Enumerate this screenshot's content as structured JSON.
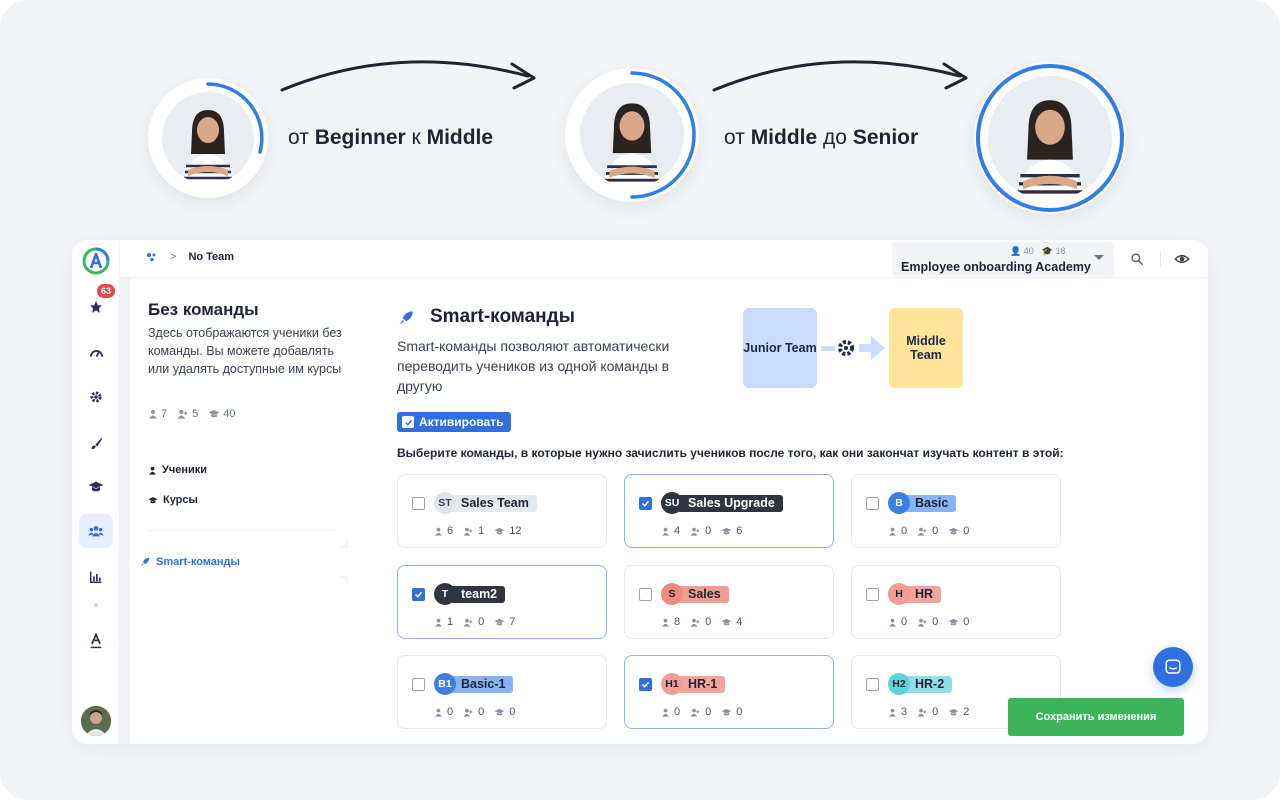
{
  "hero": {
    "step1": {
      "prefix": "от",
      "from": "Beginner",
      "mid": "к",
      "to": "Middle"
    },
    "step2": {
      "prefix": "от",
      "from": "Middle",
      "mid": "до",
      "to": "Senior"
    },
    "progress": [
      0.3,
      0.55,
      1.0
    ]
  },
  "breadcrumb": {
    "current": "No Team"
  },
  "academy": {
    "name": "Employee onboarding Academy",
    "users": "40",
    "courses": "18"
  },
  "sidebar": {
    "favorites_badge": "63"
  },
  "left_panel": {
    "title": "Без команды",
    "description": "Здесь отображаются ученики без команды. Вы можете добавлять или удалять доступные им курсы",
    "stats": {
      "users": "7",
      "teams": "5",
      "courses": "40"
    },
    "links": {
      "students": "Ученики",
      "courses": "Курсы",
      "smart_teams": "Smart-команды"
    }
  },
  "smart": {
    "title": "Smart-команды",
    "description": "Smart-команды позволяют автоматически переводить учеников из одной команды в другую",
    "activate_label": "Активировать",
    "instruction": "Выберите команды, в которые нужно зачислить учеников после того, как они закончат изучать контент в этой:",
    "illustration": {
      "from": "Junior Team",
      "to": "Middle Team"
    }
  },
  "teams": [
    {
      "initials": "ST",
      "name": "Sales Team",
      "checked": false,
      "users": "6",
      "teams": "1",
      "courses": "12",
      "circle": "#dfe3ea",
      "circle_text": "#3a4150",
      "label_bg": "#e4e8ef",
      "label_text": "#1e2433"
    },
    {
      "initials": "SU",
      "name": "Sales Upgrade",
      "checked": true,
      "users": "4",
      "teams": "0",
      "courses": "6",
      "circle": "#2f3441",
      "circle_text": "#ffffff",
      "label_bg": "#2f3441",
      "label_text": "#ffffff"
    },
    {
      "initials": "B",
      "name": "Basic",
      "checked": false,
      "users": "0",
      "teams": "0",
      "courses": "0",
      "circle": "#3d7fe0",
      "circle_text": "#ffffff",
      "label_bg": "#86b3f2",
      "label_text": "#1e2433"
    },
    {
      "initials": "T",
      "name": "team2",
      "checked": true,
      "users": "1",
      "teams": "0",
      "courses": "7",
      "circle": "#2f3441",
      "circle_text": "#ffffff",
      "label_bg": "#2f3441",
      "label_text": "#ffffff"
    },
    {
      "initials": "S",
      "name": "Sales",
      "checked": false,
      "users": "8",
      "teams": "0",
      "courses": "4",
      "circle": "#f08a7e",
      "circle_text": "#1e2433",
      "label_bg": "#f29d92",
      "label_text": "#1e2433"
    },
    {
      "initials": "H",
      "name": "HR",
      "checked": false,
      "users": "0",
      "teams": "0",
      "courses": "0",
      "circle": "#f29d92",
      "circle_text": "#1e2433",
      "label_bg": "#f4a49a",
      "label_text": "#1e2433"
    },
    {
      "initials": "B1",
      "name": "Basic-1",
      "checked": false,
      "users": "0",
      "teams": "0",
      "courses": "0",
      "circle": "#3d7fe0",
      "circle_text": "#ffffff",
      "label_bg": "#86b3f2",
      "label_text": "#1e2433"
    },
    {
      "initials": "H1",
      "name": "HR-1",
      "checked": true,
      "users": "0",
      "teams": "0",
      "courses": "0",
      "circle": "#f29d92",
      "circle_text": "#1e2433",
      "label_bg": "#f4a49a",
      "label_text": "#1e2433"
    },
    {
      "initials": "H2",
      "name": "HR-2",
      "checked": false,
      "users": "3",
      "teams": "0",
      "courses": "2",
      "circle": "#5fd3dc",
      "circle_text": "#1e2433",
      "label_bg": "#8fe0e6",
      "label_text": "#1e2433"
    }
  ],
  "save_label": "Сохранить изменения",
  "colors": {
    "accent": "#2f6fe0",
    "success": "#3cb55a",
    "badge": "#e5484d"
  }
}
